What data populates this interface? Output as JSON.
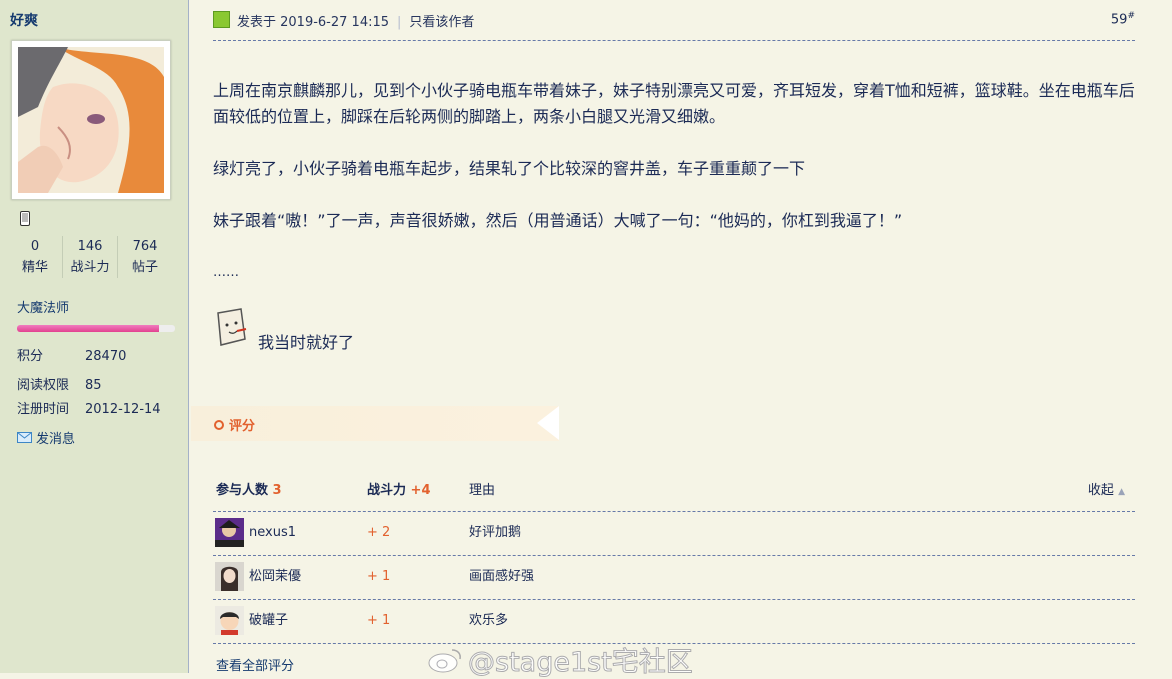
{
  "sidebar": {
    "username": "好爽",
    "stats": [
      {
        "value": "0",
        "label": "精华"
      },
      {
        "value": "146",
        "label": "战斗力"
      },
      {
        "value": "764",
        "label": "帖子"
      }
    ],
    "rank": "大魔法师",
    "rank_progress": 0.9,
    "info": [
      {
        "key": "积分",
        "value": "28470"
      },
      {
        "key": "阅读权限",
        "value": "85"
      },
      {
        "key": "注册时间",
        "value": "2012-12-14"
      }
    ],
    "message_label": "发消息"
  },
  "post": {
    "posted_at": "发表于 2019-6-27 14:15",
    "only_author": "只看该作者",
    "floor": "59",
    "floor_mark": "#",
    "paragraphs": [
      "上周在南京麒麟那儿，见到个小伙子骑电瓶车带着妹子，妹子特别漂亮又可爱，齐耳短发，穿着T恤和短裤，篮球鞋。坐在电瓶车后面较低的位置上，脚踩在后轮两侧的脚踏上，两条小白腿又光滑又细嫩。",
      "绿灯亮了，小伙子骑着电瓶车起步，结果轧了个比较深的窨井盖，车子重重颠了一下",
      "妹子跟着“嗷！”了一声，声音很娇嫩，然后（用普通话）大喊了一句：“他妈的，你杠到我逼了！”",
      "……"
    ],
    "sticker_text": "我当时就好了"
  },
  "rating": {
    "label": "评分",
    "header": {
      "participants_label": "参与人数",
      "participants_count": "3",
      "power_label": "战斗力",
      "power_total": "+4",
      "reason_label": "理由",
      "collapse_label": "收起"
    },
    "rows": [
      {
        "user": "nexus1",
        "points": "+ 2",
        "reason": "好评加鹅"
      },
      {
        "user": "松岡茉優",
        "points": "+ 1",
        "reason": "画面感好强"
      },
      {
        "user": "破罐子",
        "points": "+ 1",
        "reason": "欢乐多"
      }
    ],
    "view_all": "查看全部评分"
  },
  "watermark": "@stage1st宅社区",
  "colors": {
    "accent": "#e2612e",
    "link": "#153a6f",
    "sidebar_bg": "#dfe6cd",
    "content_bg": "#f5f4e6"
  }
}
